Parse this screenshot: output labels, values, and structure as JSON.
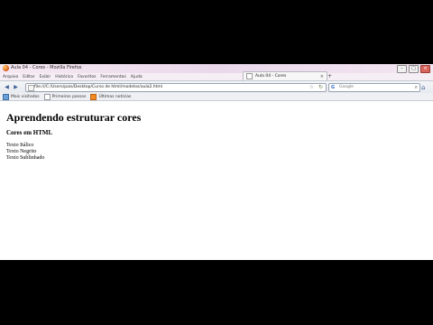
{
  "window": {
    "title": "Aula 04 - Cores - Mozilla Firefox",
    "colors": {
      "titlebar": "#f0e2ef",
      "close": "#d8655c"
    }
  },
  "menubar": {
    "items": [
      "Arquivo",
      "Editar",
      "Exibir",
      "Histórico",
      "Favoritos",
      "Ferramentas",
      "Ajuda"
    ]
  },
  "tab": {
    "label": "Aula 04 - Cores",
    "close": "×",
    "new_tab": "+"
  },
  "navbar": {
    "url": "file:///C:/Users/pais/Desktop/Curso de html/modelos/aula2.html",
    "search_placeholder": "Google",
    "icons": [
      "back-icon",
      "forward-icon",
      "reload-icon",
      "star-icon",
      "search-icon",
      "home-icon"
    ]
  },
  "bookmarks": {
    "items": [
      {
        "label": "Mais visitados",
        "icon": "star-icon"
      },
      {
        "label": "Primeiros passos",
        "icon": "page-icon"
      },
      {
        "label": "Últimas notícias",
        "icon": "rss-icon"
      }
    ]
  },
  "page": {
    "heading": "Aprendendo estruturar cores",
    "subheading": "Cores em HTML",
    "lines": [
      "Texto Itálico",
      "Texto Negrito",
      "Texto Sublinhado"
    ]
  }
}
